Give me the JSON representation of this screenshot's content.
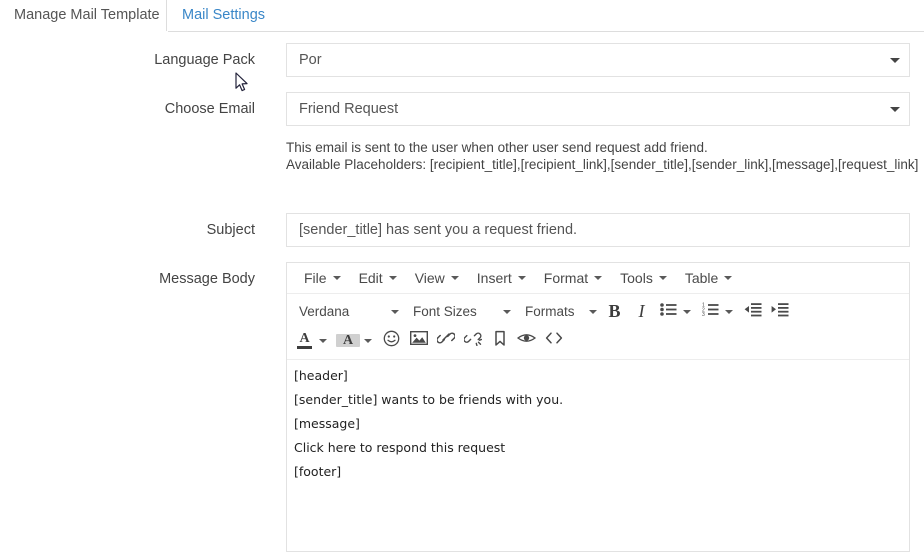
{
  "tabs": [
    {
      "label": "Manage Mail Template",
      "active": true
    },
    {
      "label": "Mail Settings",
      "active": false
    }
  ],
  "form": {
    "language_pack": {
      "label": "Language Pack",
      "value": "Por"
    },
    "choose_email": {
      "label": "Choose Email",
      "value": "Friend Request"
    },
    "help": {
      "line1": "This email is sent to the user when other user send request add friend.",
      "line2": "Available Placeholders: [recipient_title],[recipient_link],[sender_title],[sender_link],[message],[request_link]"
    },
    "subject": {
      "label": "Subject",
      "value": "[sender_title] has sent you a request friend."
    },
    "message_body": {
      "label": "Message Body"
    }
  },
  "editor": {
    "menubar": [
      "File",
      "Edit",
      "View",
      "Insert",
      "Format",
      "Tools",
      "Table"
    ],
    "toolbar_row1": {
      "font_family": "Verdana",
      "font_size": "Font Sizes",
      "formats": "Formats",
      "bold": "B",
      "italic": "I",
      "bullet_list_icon": "bullet-list-icon",
      "numbered_list_icon": "numbered-list-icon",
      "outdent_icon": "outdent-icon",
      "indent_icon": "indent-icon"
    },
    "toolbar_row2": {
      "text_color_glyph": "A",
      "background_color_glyph": "A",
      "emoticon_icon": "emoticon-icon",
      "image_icon": "image-icon",
      "link_icon": "link-icon",
      "unlink_icon": "unlink-icon",
      "anchor_icon": "anchor-bookmark-icon",
      "preview_icon": "preview-eye-icon",
      "source_code_icon": "source-code-icon"
    },
    "body": [
      "[header]",
      "[sender_title] wants to be friends with you.",
      "[message]",
      "Click here to respond this request",
      "[footer]"
    ]
  },
  "colors": {
    "link_blue": "#3a87c8",
    "text": "#444444",
    "border": "#e2e2e2"
  }
}
